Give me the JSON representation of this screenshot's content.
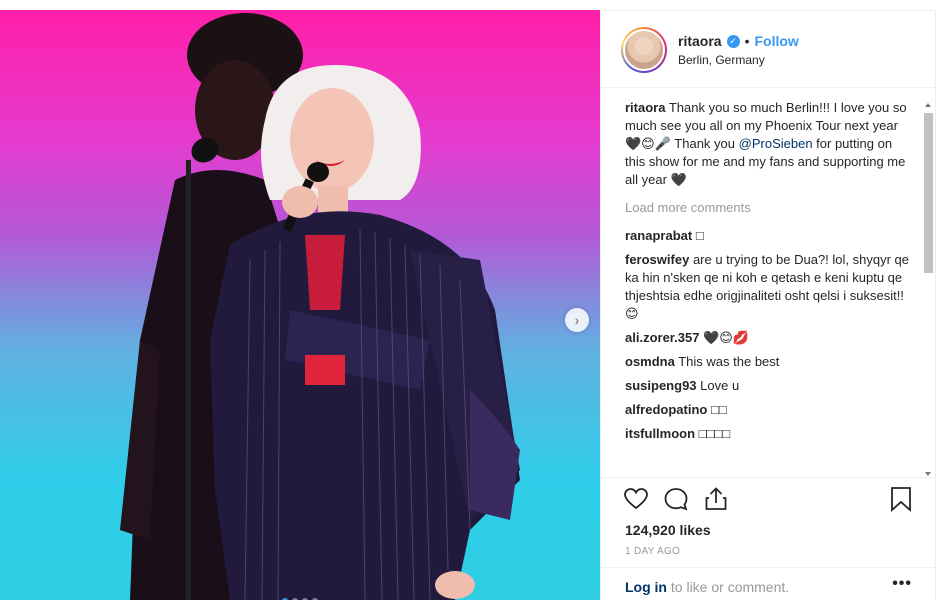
{
  "header": {
    "username": "ritaora",
    "verified_glyph": "✓",
    "separator": "•",
    "follow_label": "Follow",
    "location": "Berlin, Germany",
    "avatar_icon": "profile-avatar"
  },
  "media": {
    "next_glyph": "›",
    "carousel_count": 4,
    "active_index": 0
  },
  "caption": {
    "username": "ritaora",
    "text_before_mention": "Thank you so much Berlin!!! I love you so much see you all on my Phoenix Tour next year 🖤😊🎤 Thank you",
    "mention": "@ProSieben",
    "text_after_mention": "for putting on this show for me and my fans and supporting me all year 🖤"
  },
  "load_more_label": "Load more comments",
  "comments": [
    {
      "user": "ranaprabat",
      "text": "□"
    },
    {
      "user": "feroswifey",
      "text": "are u trying to be Dua?! lol, shyqyr qe ka hin n'sken qe ni koh e qetash e keni kuptu qe thjeshtsia edhe origjinaliteti osht qelsi i suksesit!!😊"
    },
    {
      "user": "ali.zorer.357",
      "text": "🖤😊💋"
    },
    {
      "user": "osmdna",
      "text": "This was the best"
    },
    {
      "user": "susipeng93",
      "text": "Love u"
    },
    {
      "user": "alfredopatino",
      "text": "□□"
    },
    {
      "user": "itsfullmoon",
      "text": "□□□□"
    }
  ],
  "actions": {
    "likes": "124,920 likes",
    "time": "1 DAY AGO",
    "login_link": "Log in",
    "login_suffix": "to like or comment.",
    "more_glyph": "•••"
  },
  "colors": {
    "accent": "#3897f0",
    "link_dark": "#003569",
    "muted": "#999999"
  }
}
